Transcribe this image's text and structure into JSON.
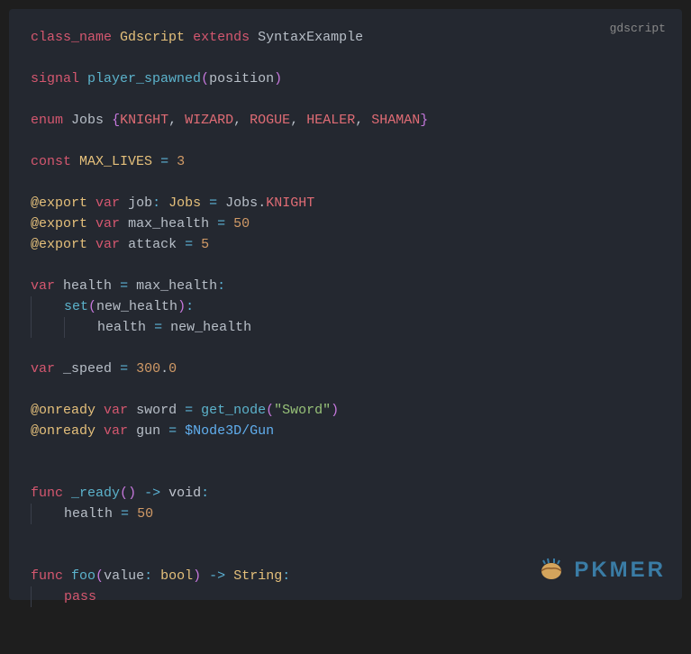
{
  "lang_label": "gdscript",
  "watermark_text": "PKMER",
  "tokens": {
    "class_name": "class_name",
    "Gdscript": "Gdscript",
    "extends": "extends",
    "SyntaxExample": "SyntaxExample",
    "signal": "signal",
    "player_spawned": "player_spawned",
    "position": "position",
    "enum": "enum",
    "Jobs": "Jobs",
    "KNIGHT": "KNIGHT",
    "WIZARD": "WIZARD",
    "ROGUE": "ROGUE",
    "HEALER": "HEALER",
    "SHAMAN": "SHAMAN",
    "const": "const",
    "MAX_LIVES": "MAX_LIVES",
    "three": "3",
    "export": "@export",
    "var": "var",
    "job": "job",
    "max_health": "max_health",
    "fifty": "50",
    "attack": "attack",
    "five": "5",
    "health": "health",
    "set": "set",
    "new_health": "new_health",
    "speed": "_speed",
    "threehundred": "300",
    "zero": "0",
    "onready": "@onready",
    "sword": "sword",
    "get_node": "get_node",
    "sword_str": "\"Sword\"",
    "gun": "gun",
    "node_path": "$Node3D/Gun",
    "func": "func",
    "ready": "_ready",
    "arrow": "->",
    "void": "void",
    "foo": "foo",
    "value": "value",
    "bool": "bool",
    "String": "String",
    "pass": "pass"
  }
}
